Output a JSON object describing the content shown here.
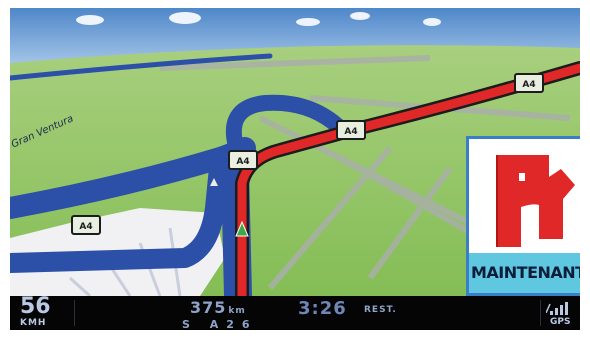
{
  "map": {
    "street_name": "Gran Ventura",
    "route_shields": [
      "A4",
      "A4",
      "A4",
      "A4"
    ],
    "colors": {
      "sky": "#6e9fd6",
      "ground": "#8cc05e",
      "highway": "#2c4fa8",
      "route": "#e02828",
      "shield": "#e8eee0",
      "road_grey": "#a9b0a8"
    }
  },
  "maneuver": {
    "label": "MAINTENANT",
    "icon": "turn-right-arrow-icon",
    "accent": "#e02828"
  },
  "status": {
    "speed": "56",
    "speed_unit": "KMH",
    "distance": "375",
    "distance_unit": "km",
    "road_code": "S A26",
    "time_remaining": "3:26",
    "time_label": "REST.",
    "gps_icon": "signal-strength-icon",
    "gps_label": "GPS"
  }
}
